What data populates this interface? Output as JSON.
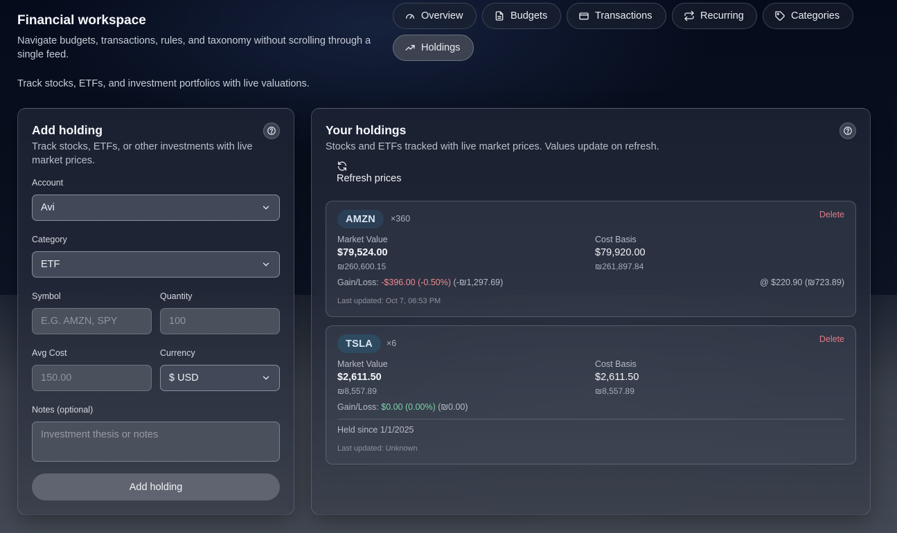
{
  "header": {
    "title": "Financial workspace",
    "description": "Navigate budgets, transactions, rules, and taxonomy without scrolling through a single feed.",
    "page_description": "Track stocks, ETFs, and investment portfolios with live valuations."
  },
  "tabs": [
    {
      "label": "Overview",
      "icon": "gauge-icon",
      "active": false
    },
    {
      "label": "Budgets",
      "icon": "document-icon",
      "active": false
    },
    {
      "label": "Transactions",
      "icon": "credit-card-icon",
      "active": false
    },
    {
      "label": "Recurring",
      "icon": "repeat-icon",
      "active": false
    },
    {
      "label": "Categories",
      "icon": "tag-icon",
      "active": false
    },
    {
      "label": "Holdings",
      "icon": "trending-up-icon",
      "active": true
    }
  ],
  "add_holding": {
    "title": "Add holding",
    "subtitle": "Track stocks, ETFs, or other investments with live market prices.",
    "account_label": "Account",
    "account_value": "Avi",
    "category_label": "Category",
    "category_value": "ETF",
    "symbol_label": "Symbol",
    "symbol_placeholder": "E.G. AMZN, SPY",
    "quantity_label": "Quantity",
    "quantity_placeholder": "100",
    "avg_cost_label": "Avg Cost",
    "avg_cost_placeholder": "150.00",
    "currency_label": "Currency",
    "currency_value": "$ USD",
    "notes_label": "Notes (optional)",
    "notes_placeholder": "Investment thesis or notes",
    "submit_label": "Add holding"
  },
  "holdings_panel": {
    "title": "Your holdings",
    "subtitle": "Stocks and ETFs tracked with live market prices. Values update on refresh.",
    "refresh_label": "Refresh prices",
    "market_value_label": "Market Value",
    "cost_basis_label": "Cost Basis",
    "gain_loss_label": "Gain/Loss:",
    "delete_label": "Delete"
  },
  "holdings": [
    {
      "symbol": "AMZN",
      "quantity": "×360",
      "market_value": "$79,524.00",
      "market_value_ils": "₪260,600.15",
      "cost_basis": "$79,920.00",
      "cost_basis_ils": "₪261,897.84",
      "gain": "-$396.00 (-0.50%)",
      "gain_ils": "(-₪1,297.69)",
      "avg_price": "@ $220.90 (₪723.89)",
      "last_updated": "Last updated: Oct 7, 06:53 PM"
    },
    {
      "symbol": "TSLA",
      "quantity": "×6",
      "market_value": "$2,611.50",
      "market_value_ils": "₪8,557.89",
      "cost_basis": "$2,611.50",
      "cost_basis_ils": "₪8,557.89",
      "gain": "$0.00 (0.00%)",
      "gain_ils": "(₪0.00)",
      "held_since": "Held since 1/1/2025",
      "last_updated": "Last updated: Unknown"
    }
  ],
  "colors": {
    "loss": "#f08a8f",
    "gain": "#7dd6a8",
    "delete": "#e07b86",
    "symbol_badge": "#2b4056"
  }
}
